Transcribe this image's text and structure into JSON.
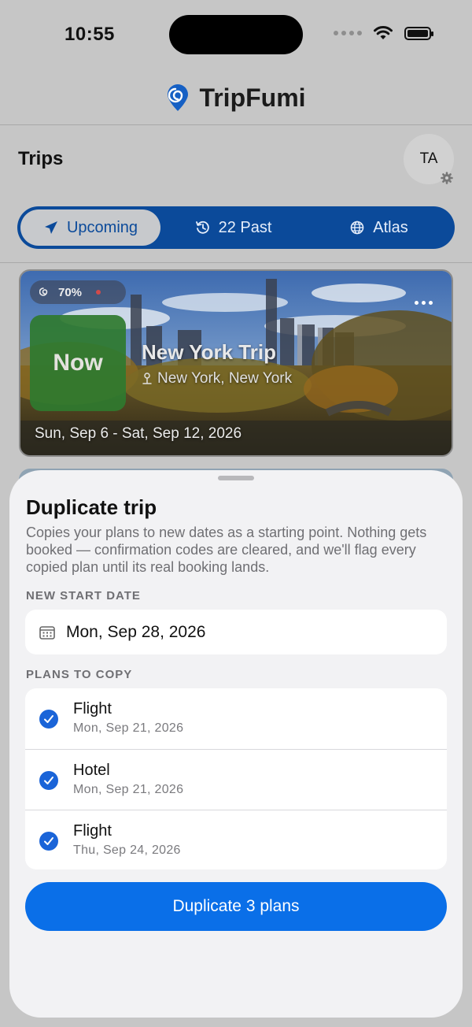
{
  "status": {
    "time": "10:55"
  },
  "app": {
    "name": "TripFumi"
  },
  "trips_title": "Trips",
  "avatar_initials": "TA",
  "tabs": [
    {
      "label": "Upcoming",
      "icon": "plane-icon",
      "active": true
    },
    {
      "label": "22 Past",
      "icon": "history-icon",
      "active": false
    },
    {
      "label": "Atlas",
      "icon": "globe-icon",
      "active": false
    }
  ],
  "trip_card": {
    "progress_label": "70%",
    "badge": "Now",
    "name": "New York Trip",
    "location": "New York, New York",
    "dates": "Sun, Sep 6 - Sat, Sep 12, 2026"
  },
  "sheet": {
    "title": "Duplicate trip",
    "description": "Copies your plans to new dates as a starting point. Nothing gets booked — confirmation codes are cleared, and we'll flag every copied plan until its real booking lands.",
    "start_date_label": "NEW START DATE",
    "start_date_value": "Mon, Sep 28, 2026",
    "plans_label": "PLANS TO COPY",
    "plans": [
      {
        "name": "Flight",
        "date": "Mon, Sep 21, 2026",
        "checked": true
      },
      {
        "name": "Hotel",
        "date": "Mon, Sep 21, 2026",
        "checked": true
      },
      {
        "name": "Flight",
        "date": "Thu, Sep 24, 2026",
        "checked": true
      }
    ],
    "button_label": "Duplicate 3 plans"
  },
  "colors": {
    "accent": "#0a6fe8",
    "segment_bg": "#0b4a9a",
    "badge_green": "#2f7a2f",
    "checkbox": "#1a64d8"
  }
}
